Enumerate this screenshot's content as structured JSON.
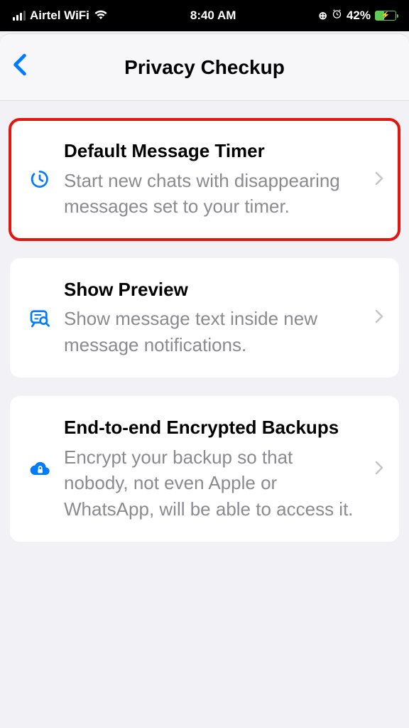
{
  "status_bar": {
    "carrier": "Airtel WiFi",
    "time": "8:40 AM",
    "battery_pct": "42%"
  },
  "header": {
    "title": "Privacy Checkup"
  },
  "cards": [
    {
      "title": "Default Message Timer",
      "desc": "Start new chats with disappearing messages set to your timer."
    },
    {
      "title": "Show Preview",
      "desc": "Show message text inside new message notifications."
    },
    {
      "title": "End-to-end Encrypted Backups",
      "desc": "Encrypt your backup so that nobody, not even Apple or WhatsApp, will be able to access it."
    }
  ]
}
